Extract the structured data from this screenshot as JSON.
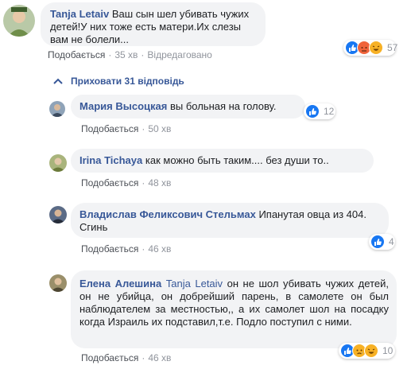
{
  "comments": [
    {
      "author": "Tanja Letaiv",
      "text": "Ваш сын шел убивать чужих детей!У них тоже есть матери.Их слезы вам не болели...",
      "like_label": "Подобається",
      "time": "35 хв",
      "edited_label": "Відредаговано",
      "reaction_count": "57",
      "reactions": [
        "like-icon",
        "angry-icon",
        "haha-icon"
      ]
    }
  ],
  "hide_replies_label": "Приховати 31 відповідь",
  "replies": [
    {
      "author": "Мария Высоцкая",
      "text": "вы больная на голову.",
      "like_label": "Подобається",
      "time": "50 хв",
      "reaction_count": "12",
      "reactions": [
        "like-icon"
      ]
    },
    {
      "author": "Irina Tichaya",
      "text": "как можно быть таким.... без души то..",
      "like_label": "Подобається",
      "time": "48 хв"
    },
    {
      "author": "Владислав Феликсович Стельмах",
      "text": "Ипанутая овца из 404. Сгинь",
      "like_label": "Подобається",
      "time": "46 хв",
      "reaction_count": "4",
      "reactions": [
        "like-icon"
      ]
    },
    {
      "author": "Елена Алешина",
      "mention": "Tanja Letaiv",
      "text": "он не шол убивать чужих детей, он не убийца, он добрейший парень, в самолете он был наблюдателем за местностью,, а их самолет шол на посадку когда Израиль их подставил,т.е. Подло поступил с ними.",
      "like_label": "Подобається",
      "time": "46 хв",
      "reaction_count": "10",
      "reactions": [
        "like-icon",
        "sad-icon",
        "haha-icon"
      ]
    }
  ],
  "colors": {
    "link": "#385898",
    "bubble": "#f2f3f5",
    "meta": "#90949c",
    "like": "#1877f2",
    "angry": "#f0633a",
    "haha": "#f7b125",
    "sad": "#f7b125"
  }
}
